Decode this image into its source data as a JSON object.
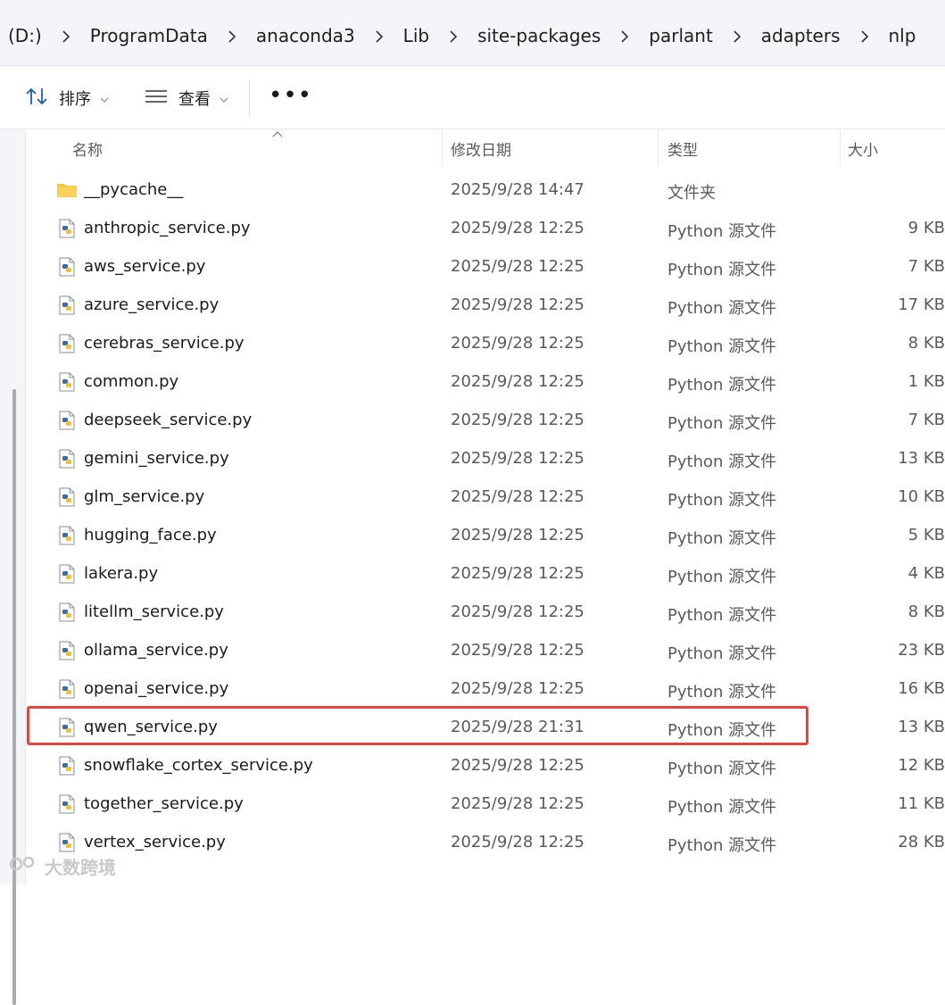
{
  "breadcrumb": [
    "(D:)",
    "ProgramData",
    "anaconda3",
    "Lib",
    "site-packages",
    "parlant",
    "adapters",
    "nlp"
  ],
  "toolbar": {
    "sort_label": "排序",
    "view_label": "查看",
    "more_label": "•••"
  },
  "columns": {
    "name": "名称",
    "date": "修改日期",
    "type": "类型",
    "size": "大小"
  },
  "files": [
    {
      "name": "__pycache__",
      "date": "2025/9/28 14:47",
      "type": "文件夹",
      "size": "",
      "icon": "folder-icon"
    },
    {
      "name": "anthropic_service.py",
      "date": "2025/9/28 12:25",
      "type": "Python 源文件",
      "size": "9 KB",
      "icon": "python-file-icon"
    },
    {
      "name": "aws_service.py",
      "date": "2025/9/28 12:25",
      "type": "Python 源文件",
      "size": "7 KB",
      "icon": "python-file-icon"
    },
    {
      "name": "azure_service.py",
      "date": "2025/9/28 12:25",
      "type": "Python 源文件",
      "size": "17 KB",
      "icon": "python-file-icon"
    },
    {
      "name": "cerebras_service.py",
      "date": "2025/9/28 12:25",
      "type": "Python 源文件",
      "size": "8 KB",
      "icon": "python-file-icon"
    },
    {
      "name": "common.py",
      "date": "2025/9/28 12:25",
      "type": "Python 源文件",
      "size": "1 KB",
      "icon": "python-file-icon"
    },
    {
      "name": "deepseek_service.py",
      "date": "2025/9/28 12:25",
      "type": "Python 源文件",
      "size": "7 KB",
      "icon": "python-file-icon"
    },
    {
      "name": "gemini_service.py",
      "date": "2025/9/28 12:25",
      "type": "Python 源文件",
      "size": "13 KB",
      "icon": "python-file-icon"
    },
    {
      "name": "glm_service.py",
      "date": "2025/9/28 12:25",
      "type": "Python 源文件",
      "size": "10 KB",
      "icon": "python-file-icon"
    },
    {
      "name": "hugging_face.py",
      "date": "2025/9/28 12:25",
      "type": "Python 源文件",
      "size": "5 KB",
      "icon": "python-file-icon"
    },
    {
      "name": "lakera.py",
      "date": "2025/9/28 12:25",
      "type": "Python 源文件",
      "size": "4 KB",
      "icon": "python-file-icon"
    },
    {
      "name": "litellm_service.py",
      "date": "2025/9/28 12:25",
      "type": "Python 源文件",
      "size": "8 KB",
      "icon": "python-file-icon"
    },
    {
      "name": "ollama_service.py",
      "date": "2025/9/28 12:25",
      "type": "Python 源文件",
      "size": "23 KB",
      "icon": "python-file-icon"
    },
    {
      "name": "openai_service.py",
      "date": "2025/9/28 12:25",
      "type": "Python 源文件",
      "size": "16 KB",
      "icon": "python-file-icon"
    },
    {
      "name": "qwen_service.py",
      "date": "2025/9/28 21:31",
      "type": "Python 源文件",
      "size": "13 KB",
      "icon": "python-file-icon"
    },
    {
      "name": "snowflake_cortex_service.py",
      "date": "2025/9/28 12:25",
      "type": "Python 源文件",
      "size": "12 KB",
      "icon": "python-file-icon"
    },
    {
      "name": "together_service.py",
      "date": "2025/9/28 12:25",
      "type": "Python 源文件",
      "size": "11 KB",
      "icon": "python-file-icon"
    },
    {
      "name": "vertex_service.py",
      "date": "2025/9/28 12:25",
      "type": "Python 源文件",
      "size": "28 KB",
      "icon": "python-file-icon"
    }
  ],
  "highlighted_file": "qwen_service.py",
  "watermark": "大数跨境",
  "colors": {
    "highlight": "#e0443f",
    "folder": "#f4c441",
    "python": "#3b6ea5"
  }
}
